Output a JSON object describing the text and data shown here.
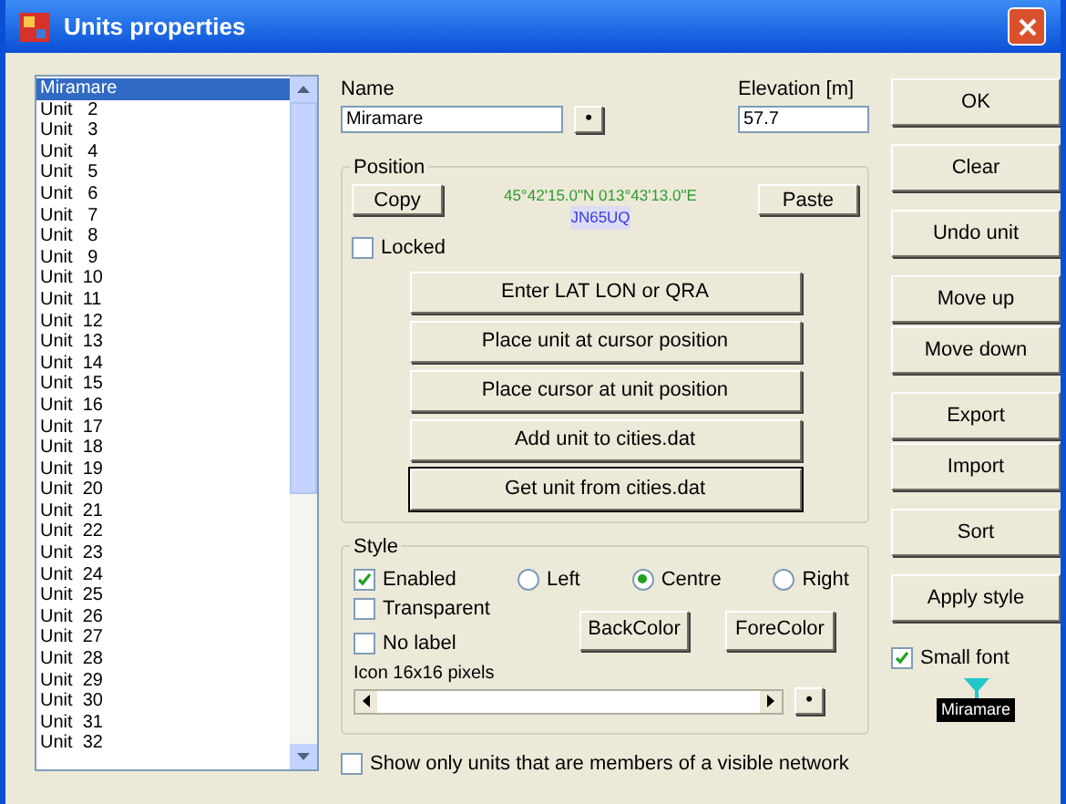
{
  "window": {
    "title": "Units properties"
  },
  "units": [
    {
      "label": "Miramare",
      "selected": true
    },
    {
      "label": "Unit   2",
      "selected": false
    },
    {
      "label": "Unit   3",
      "selected": false
    },
    {
      "label": "Unit   4",
      "selected": false
    },
    {
      "label": "Unit   5",
      "selected": false
    },
    {
      "label": "Unit   6",
      "selected": false
    },
    {
      "label": "Unit   7",
      "selected": false
    },
    {
      "label": "Unit   8",
      "selected": false
    },
    {
      "label": "Unit   9",
      "selected": false
    },
    {
      "label": "Unit  10",
      "selected": false
    },
    {
      "label": "Unit  11",
      "selected": false
    },
    {
      "label": "Unit  12",
      "selected": false
    },
    {
      "label": "Unit  13",
      "selected": false
    },
    {
      "label": "Unit  14",
      "selected": false
    },
    {
      "label": "Unit  15",
      "selected": false
    },
    {
      "label": "Unit  16",
      "selected": false
    },
    {
      "label": "Unit  17",
      "selected": false
    },
    {
      "label": "Unit  18",
      "selected": false
    },
    {
      "label": "Unit  19",
      "selected": false
    },
    {
      "label": "Unit  20",
      "selected": false
    },
    {
      "label": "Unit  21",
      "selected": false
    },
    {
      "label": "Unit  22",
      "selected": false
    },
    {
      "label": "Unit  23",
      "selected": false
    },
    {
      "label": "Unit  24",
      "selected": false
    },
    {
      "label": "Unit  25",
      "selected": false
    },
    {
      "label": "Unit  26",
      "selected": false
    },
    {
      "label": "Unit  27",
      "selected": false
    },
    {
      "label": "Unit  28",
      "selected": false
    },
    {
      "label": "Unit  29",
      "selected": false
    },
    {
      "label": "Unit  30",
      "selected": false
    },
    {
      "label": "Unit  31",
      "selected": false
    },
    {
      "label": "Unit  32",
      "selected": false
    }
  ],
  "name": {
    "label": "Name",
    "value": "Miramare",
    "button": "•"
  },
  "elevation": {
    "label": "Elevation [m]",
    "value": "57.7"
  },
  "position": {
    "title": "Position",
    "copy": "Copy",
    "paste": "Paste",
    "coordinates": "45°42'15.0\"N 013°43'13.0\"E",
    "locator": "JN65UQ",
    "locked": {
      "label": "Locked",
      "checked": false
    },
    "actions": [
      {
        "label": "Enter LAT LON or QRA",
        "default": false
      },
      {
        "label": "Place unit at cursor position",
        "default": false
      },
      {
        "label": "Place cursor at unit position",
        "default": false
      },
      {
        "label": "Add unit to cities.dat",
        "default": false
      },
      {
        "label": "Get unit from cities.dat",
        "default": true
      }
    ]
  },
  "style": {
    "title": "Style",
    "enabled": {
      "label": "Enabled",
      "checked": true
    },
    "alignment": [
      {
        "label": "Left",
        "selected": false
      },
      {
        "label": "Centre",
        "selected": true
      },
      {
        "label": "Right",
        "selected": false
      }
    ],
    "transparent": {
      "label": "Transparent",
      "checked": false
    },
    "no_label": {
      "label": "No label",
      "checked": false
    },
    "back_color": "BackColor",
    "fore_color": "ForeColor",
    "icon_label": "Icon 16x16 pixels",
    "icon_button": "•"
  },
  "show_only_network": {
    "label": "Show only units that are members of a visible network",
    "checked": false
  },
  "side_buttons": [
    "OK",
    "Clear",
    "Undo unit",
    "Move up",
    "Move down",
    "Export",
    "Import",
    "Sort",
    "Apply style"
  ],
  "small_font": {
    "label": "Small font",
    "checked": true
  },
  "preview_label": "Miramare"
}
